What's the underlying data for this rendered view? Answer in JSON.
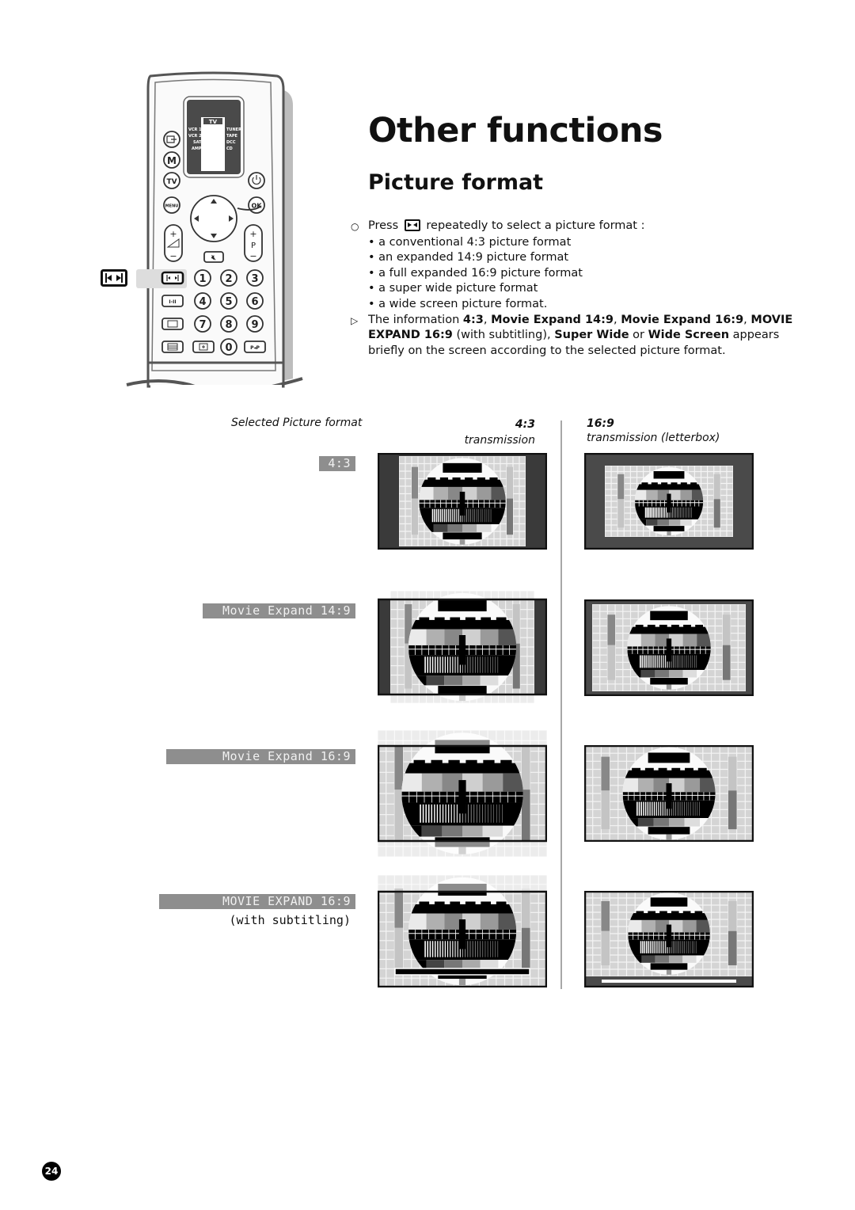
{
  "page": {
    "title": "Other functions",
    "subtitle": "Picture format",
    "page_number": "24"
  },
  "remote": {
    "display_header": "TV",
    "display_left": [
      "VCR 1",
      "VCR 2",
      "SAT",
      "AMP"
    ],
    "display_right": [
      "TUNER",
      "TAPE",
      "DCC",
      "CD"
    ],
    "buttons": {
      "m": "M",
      "tv": "TV",
      "menu": "MENU",
      "ok": "OK",
      "p": "P",
      "plus": "+",
      "minus": "−",
      "dual": "I-II",
      "swap": "P◂P",
      "digits": [
        "1",
        "2",
        "3",
        "4",
        "5",
        "6",
        "7",
        "8",
        "9",
        "0"
      ]
    },
    "highlighted_button": "picture-format"
  },
  "instructions": {
    "press_prefix": "Press",
    "press_suffix": "repeatedly to select a picture format :",
    "bullets": [
      "• a conventional 4:3 picture format",
      "• an expanded 14:9 picture format",
      "• a full expanded 16:9 picture format",
      "• a super wide picture format",
      "• a wide screen picture format."
    ],
    "note": {
      "t1": "The information ",
      "b1": "4:3",
      "t2": ", ",
      "b2": "Movie Expand 14:9",
      "t3": ", ",
      "b3": "Movie Expand 16:9",
      "t4": ", ",
      "b4": "MOVIE EXPAND 16:9",
      "t5": " (with subtitling), ",
      "b5": "Super Wide",
      "t6": " or ",
      "b6": "Wide Screen",
      "t7": " appears briefly on the screen according to the selected picture format."
    },
    "markers": {
      "step": "○",
      "note": "▷"
    }
  },
  "table": {
    "header_selected": "Selected Picture format",
    "header_43_bold": "4:3",
    "header_43_sub": "transmission",
    "header_169_bold": "16:9",
    "header_169_sub": "transmission (letterbox)",
    "rows": [
      {
        "osd": "4:3",
        "extra": ""
      },
      {
        "osd": "Movie Expand 14:9",
        "extra": ""
      },
      {
        "osd": "Movie Expand 16:9",
        "extra": ""
      },
      {
        "osd": "MOVIE EXPAND 16:9",
        "extra": "(with subtitling)"
      }
    ]
  },
  "colors": {
    "osd_bg": "#8e8e8e",
    "bar_dark": "#3a3a3a",
    "letterbox": "#4a4a4a"
  }
}
